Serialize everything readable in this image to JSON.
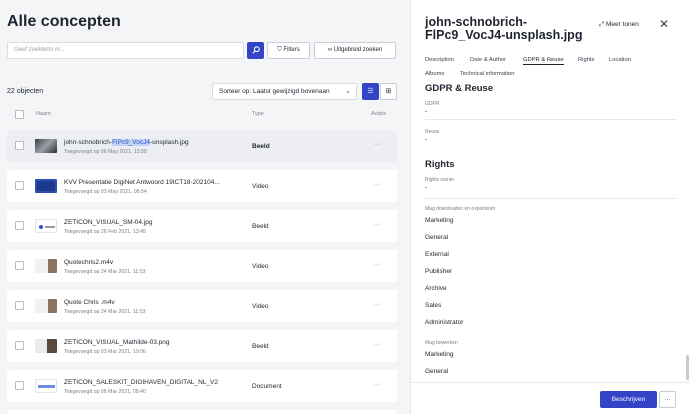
{
  "header": {
    "title": "Alle concepten",
    "search_placeholder": "Geef zoekterm in...",
    "filters_label": "Filters",
    "advanced_search_label": "Uitgebreid zoeken"
  },
  "listbar": {
    "count": "22 objecten",
    "sort_label": "Sorteer op: Laatst gewijzigd bovenaan"
  },
  "table": {
    "col_name": "Naam",
    "col_type": "Type",
    "col_actions": "Acties",
    "rows": [
      {
        "name_pre": "john-schnobrich-",
        "name_hl": "FlPc9_VocJ4",
        "name_post": "-unsplash.jpg",
        "date": "Toegevoegd op 06 May 2021, 13:58",
        "type": "Beeld"
      },
      {
        "name_pre": "KVV Presentatie DigiNet Antwoord 19ICT18-202104...",
        "name_hl": "",
        "name_post": "",
        "date": "Toegevoegd op 03 May 2021, 08:54",
        "type": "Video"
      },
      {
        "name_pre": "ZETICON_VISUAL_SM-04.jpg",
        "name_hl": "",
        "name_post": "",
        "date": "Toegevoegd op 26 Feb 2021, 13:45",
        "type": "Beeld"
      },
      {
        "name_pre": "Quotechris2.m4v",
        "name_hl": "",
        "name_post": "",
        "date": "Toegevoegd op 24 Mar 2021, 11:53",
        "type": "Video"
      },
      {
        "name_pre": "Quote Chris .m4v",
        "name_hl": "",
        "name_post": "",
        "date": "Toegevoegd op 24 Mar 2021, 11:53",
        "type": "Video"
      },
      {
        "name_pre": "ZETICON_VISUAL_Mathilde-03.png",
        "name_hl": "",
        "name_post": "",
        "date": "Toegevoegd op 03 Mar 2021, 19:06",
        "type": "Beeld"
      },
      {
        "name_pre": "ZETICON_SALESKIT_DIGIHAVEN_DIGITAL_NL_V2",
        "name_hl": "",
        "name_post": "",
        "date": "Toegevoegd op 08 Mar 2021, 08:40",
        "type": "Document"
      }
    ]
  },
  "detail": {
    "title": "john-schnobrich-FlPc9_VocJ4-unsplash.jpg",
    "more_label": "Meer tonen",
    "tabs": [
      "Description",
      "Date & Author",
      "GDPR & Reuse",
      "Rights",
      "Location",
      "Albums",
      "Technical information"
    ],
    "gdpr_section": "GDPR & Reuse",
    "gdpr_label": "GDPR",
    "gdpr_value": "-",
    "reuse_label": "Reuse",
    "reuse_value": "-",
    "rights_section": "Rights",
    "rights_owner_label": "Rights owner",
    "rights_owner_value": "-",
    "download_label": "Mag downloaden en exporteren",
    "download_values": [
      "Marketing",
      "General",
      "External",
      "Publisher",
      "Archive",
      "Sales",
      "Administrator"
    ],
    "edit_label": "Mag bewerken",
    "edit_values": [
      "Marketing",
      "General"
    ],
    "describe_button": "Beschrijven",
    "more_button": "..."
  },
  "colors": {
    "accent": "#3344c7",
    "highlight": "#c3d3f5"
  }
}
